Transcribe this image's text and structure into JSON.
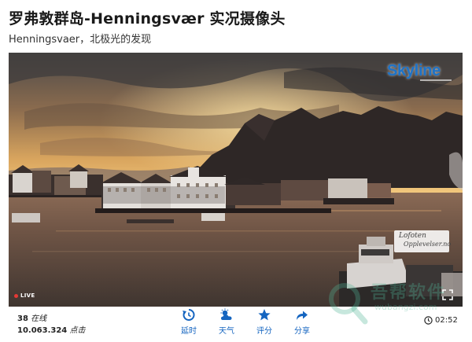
{
  "page": {
    "title": "罗弗敦群岛-Henningsvær 实况摄像头",
    "subtitle": "Henningsvaer，北极光的发现"
  },
  "player": {
    "logo": "Skyline",
    "sign_line1": "Lofoten",
    "sign_line2": "Opplevelser.no",
    "live_label": "LIVE"
  },
  "stats": {
    "online_count": "38",
    "online_label": "在线",
    "clicks_count": "10.063.324",
    "clicks_label": "点击"
  },
  "actions": [
    {
      "label": "延时",
      "icon": "timelapse-icon"
    },
    {
      "label": "天气",
      "icon": "weather-icon"
    },
    {
      "label": "评分",
      "icon": "star-icon"
    },
    {
      "label": "分享",
      "icon": "share-icon"
    }
  ],
  "duration": "02:52",
  "watermark": {
    "cn": "吾帮软件",
    "en": "wubangzi.com"
  },
  "colors": {
    "accent": "#1565c0",
    "live": "#e53935",
    "logo": "#1e73c8"
  }
}
